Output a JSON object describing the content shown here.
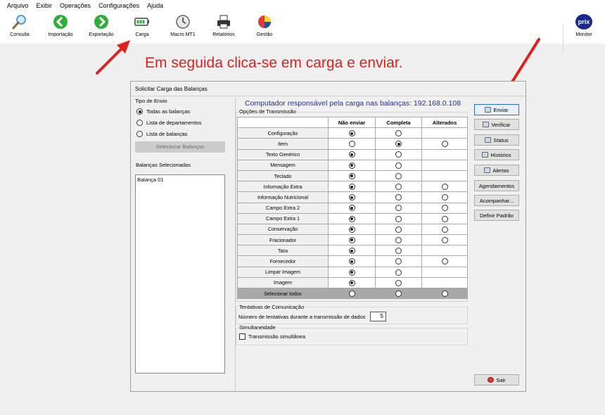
{
  "menu": [
    "Arquivo",
    "Exibir",
    "Operações",
    "Configurações",
    "Ajuda"
  ],
  "toolbar": [
    {
      "label": "Consulta",
      "icon": "magnifier-icon"
    },
    {
      "label": "Importação",
      "icon": "arrow-left-icon"
    },
    {
      "label": "Exportação",
      "icon": "arrow-right-icon"
    },
    {
      "label": "Carga",
      "icon": "battery-icon"
    },
    {
      "label": "Macro MT1",
      "icon": "clock-icon"
    },
    {
      "label": "Relatórios",
      "icon": "printer-icon"
    },
    {
      "label": "Gestão",
      "icon": "pie-chart-icon"
    },
    {
      "label": "Monitor",
      "icon": "prix-logo"
    }
  ],
  "logo_text": "prix",
  "annotation": "Em seguida clica-se em carga e enviar.",
  "colors": {
    "annotation": "#e0201c",
    "computer_text": "#1f2fa0",
    "selected_row": "#a8a8a8",
    "icon_green": "#2fae3a"
  },
  "dialog": {
    "title": "Solicitar Carga das Balanças",
    "tipo_envio": {
      "title": "Tipo de Envio",
      "options": [
        "Todas as balanças",
        "Lista de departamentos",
        "Lista de balanças"
      ],
      "selected": "Todas as balanças"
    },
    "select_button": "Selecionar Balanças",
    "selected_title": "Balanças Selecionadas",
    "selected_list": [
      "Balança 01"
    ],
    "computer_label": "Computador responsável pela carga nas balanças: 192.168.0.108",
    "options_title": "Opções de Transmissão",
    "columns": [
      "",
      "Não enviar",
      "Completa",
      "Alterados"
    ],
    "rows": [
      {
        "name": "Configuração",
        "choice": "nao",
        "alterados": false
      },
      {
        "name": "Item",
        "choice": "completa",
        "alterados": true
      },
      {
        "name": "Texto Genérico",
        "choice": "nao",
        "alterados": false
      },
      {
        "name": "Mensagem",
        "choice": "nao",
        "alterados": false
      },
      {
        "name": "Teclado",
        "choice": "nao",
        "alterados": false
      },
      {
        "name": "Informação Extra",
        "choice": "nao",
        "alterados": true
      },
      {
        "name": "Informação Nutricional",
        "choice": "nao",
        "alterados": true
      },
      {
        "name": "Campo Extra 2",
        "choice": "nao",
        "alterados": true
      },
      {
        "name": "Campo Extra 1",
        "choice": "nao",
        "alterados": true
      },
      {
        "name": "Conservação",
        "choice": "nao",
        "alterados": true
      },
      {
        "name": "Fracionador",
        "choice": "nao",
        "alterados": true
      },
      {
        "name": "Tara",
        "choice": "nao",
        "alterados": false
      },
      {
        "name": "Fornecedor",
        "choice": "nao",
        "alterados": true
      },
      {
        "name": "Limpar Imagem",
        "choice": "nao",
        "alterados": false
      },
      {
        "name": "Imagem",
        "choice": "nao",
        "alterados": false
      },
      {
        "name": "Selecionar todos",
        "choice": "none",
        "alterados": true,
        "selected": true
      }
    ],
    "tentativas_title": "Tentativas de Comunicação",
    "tentativas_label": "Número de tentativas durante a transmissão de dados",
    "tentativas_value": "5",
    "simult_title": "Simultaneidade",
    "simult_label": "Transmissão simultânea",
    "buttons": [
      "Enviar",
      "Verificar",
      "Status",
      "Histórico",
      "Alertas",
      "Agendamentos",
      "Acompanhar...",
      "Definir Padrão"
    ],
    "exit_button": "Sair"
  }
}
